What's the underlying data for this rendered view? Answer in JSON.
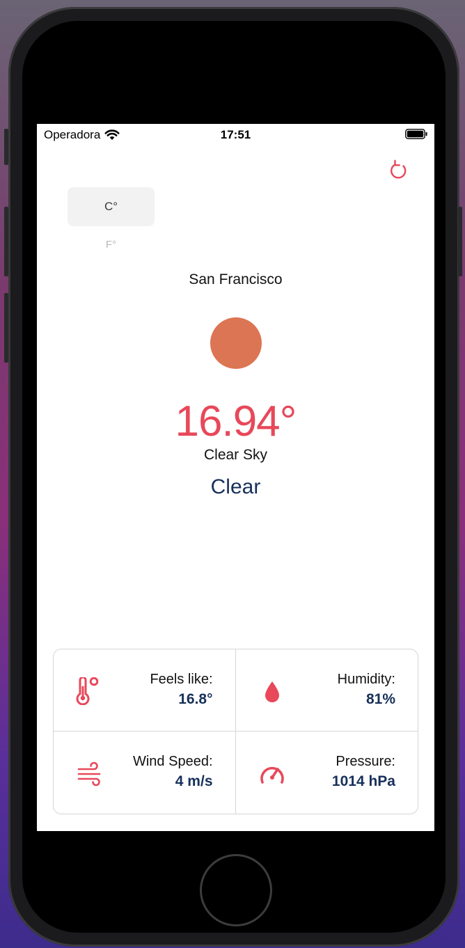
{
  "status_bar": {
    "carrier": "Operadora",
    "time": "17:51"
  },
  "units": {
    "celsius": "C°",
    "fahrenheit": "F°"
  },
  "weather": {
    "city": "San Francisco",
    "temperature": "16.94°",
    "description": "Clear Sky",
    "main": "Clear"
  },
  "details": [
    {
      "label": "Feels like:",
      "value": "16.8°",
      "icon": "thermometer-icon"
    },
    {
      "label": "Humidity:",
      "value": "81%",
      "icon": "droplet-icon"
    },
    {
      "label": "Wind Speed:",
      "value": "4 m/s",
      "icon": "wind-icon"
    },
    {
      "label": "Pressure:",
      "value": "1014 hPa",
      "icon": "gauge-icon"
    }
  ],
  "colors": {
    "accent_red": "#e8485a",
    "sun": "#dc7553",
    "navy": "#17305a"
  }
}
